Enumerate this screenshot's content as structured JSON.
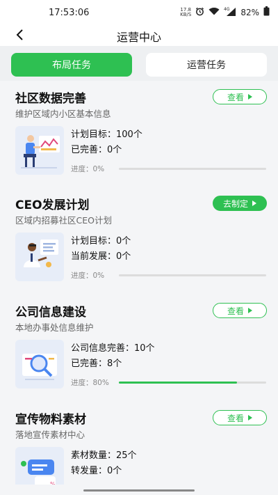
{
  "status_bar": {
    "time": "17:53:06",
    "speed": "17.8",
    "speed_unit": "KB/S",
    "signal": "4G",
    "battery": "82%",
    "icons": [
      "alarm-icon",
      "wifi-icon",
      "signal-icon",
      "battery-icon"
    ]
  },
  "header": {
    "title": "运营中心",
    "back_icon": "back-arrow-icon"
  },
  "tabs": [
    {
      "label": "布局任务",
      "active": true
    },
    {
      "label": "运营任务",
      "active": false
    }
  ],
  "colors": {
    "accent": "#2ec052",
    "track": "#dcdcdc",
    "thumb_bg": "#e7edf8"
  },
  "cards": [
    {
      "title": "社区数据完善",
      "subtitle": "维护区域内小区基本信息",
      "action": "查看",
      "action_style": "outline",
      "line1": "计划目标：100个",
      "line2": "已完善：0个",
      "progress_label": "进度：0%",
      "progress": 0
    },
    {
      "title": "CEO发展计划",
      "subtitle": "区域内招募社区CEO计划",
      "action": "去制定",
      "action_style": "solid",
      "line1": "计划目标：0个",
      "line2": "当前发展：0个",
      "progress_label": "进度：0%",
      "progress": 0
    },
    {
      "title": "公司信息建设",
      "subtitle": "本地办事处信息维护",
      "action": "查看",
      "action_style": "outline",
      "line1": "公司信息完善：10个",
      "line2": "已完善：8个",
      "progress_label": "进度：80%",
      "progress": 0.8
    },
    {
      "title": "宣传物料素材",
      "subtitle": "落地宣传素材中心",
      "action": "查看",
      "action_style": "outline",
      "line1": "素材数量：25个",
      "line2": "转发量：0个",
      "progress_label": "",
      "progress": null
    }
  ]
}
